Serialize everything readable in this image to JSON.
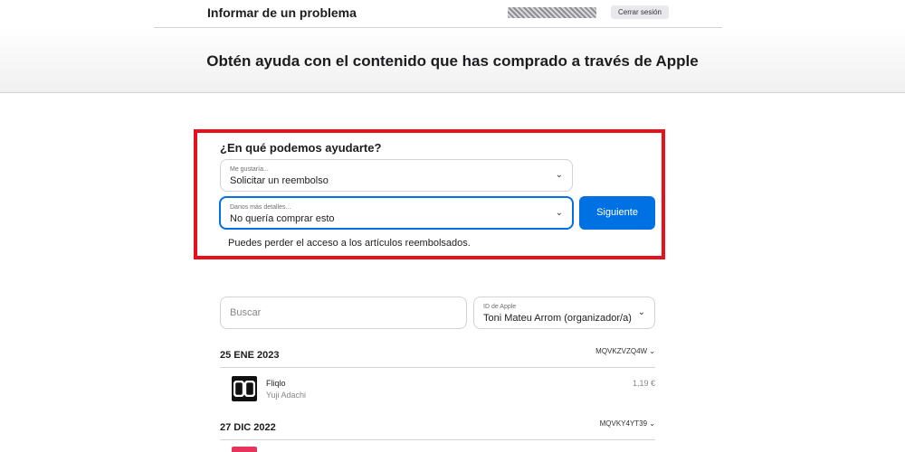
{
  "header": {
    "title": "Informar de un problema",
    "signout_label": "Cerrar sesión"
  },
  "banner": {
    "title": "Obtén ayuda con el contenido que has comprado a través de Apple"
  },
  "help_form": {
    "title": "¿En qué podemos ayudarte?",
    "reason_select": {
      "label": "Me gustaría...",
      "value": "Solicitar un reembolso"
    },
    "details_select": {
      "label": "Danos más detalles...",
      "value": "No quería comprar esto"
    },
    "next_label": "Siguiente",
    "warning": "Puedes perder el acceso a los artículos reembolsados."
  },
  "filters": {
    "search_placeholder": "Buscar",
    "appleid_select": {
      "label": "ID de Apple",
      "value": "Toni Mateu Arrom (organizador/a)"
    }
  },
  "purchases": [
    {
      "date": "25 ENE 2023",
      "order_id": "MQVKZVZQ4W",
      "items": [
        {
          "name": "Fliqlo",
          "developer": "Yuji Adachi",
          "price": "1,19 €",
          "icon_text": "00"
        }
      ]
    },
    {
      "date": "27 DIC 2022",
      "order_id": "MQVKY4YT39"
    }
  ],
  "icons": {
    "chevron": "chevron-down-icon",
    "highlight_color": "#e8101a",
    "accent": "#0071e3"
  }
}
